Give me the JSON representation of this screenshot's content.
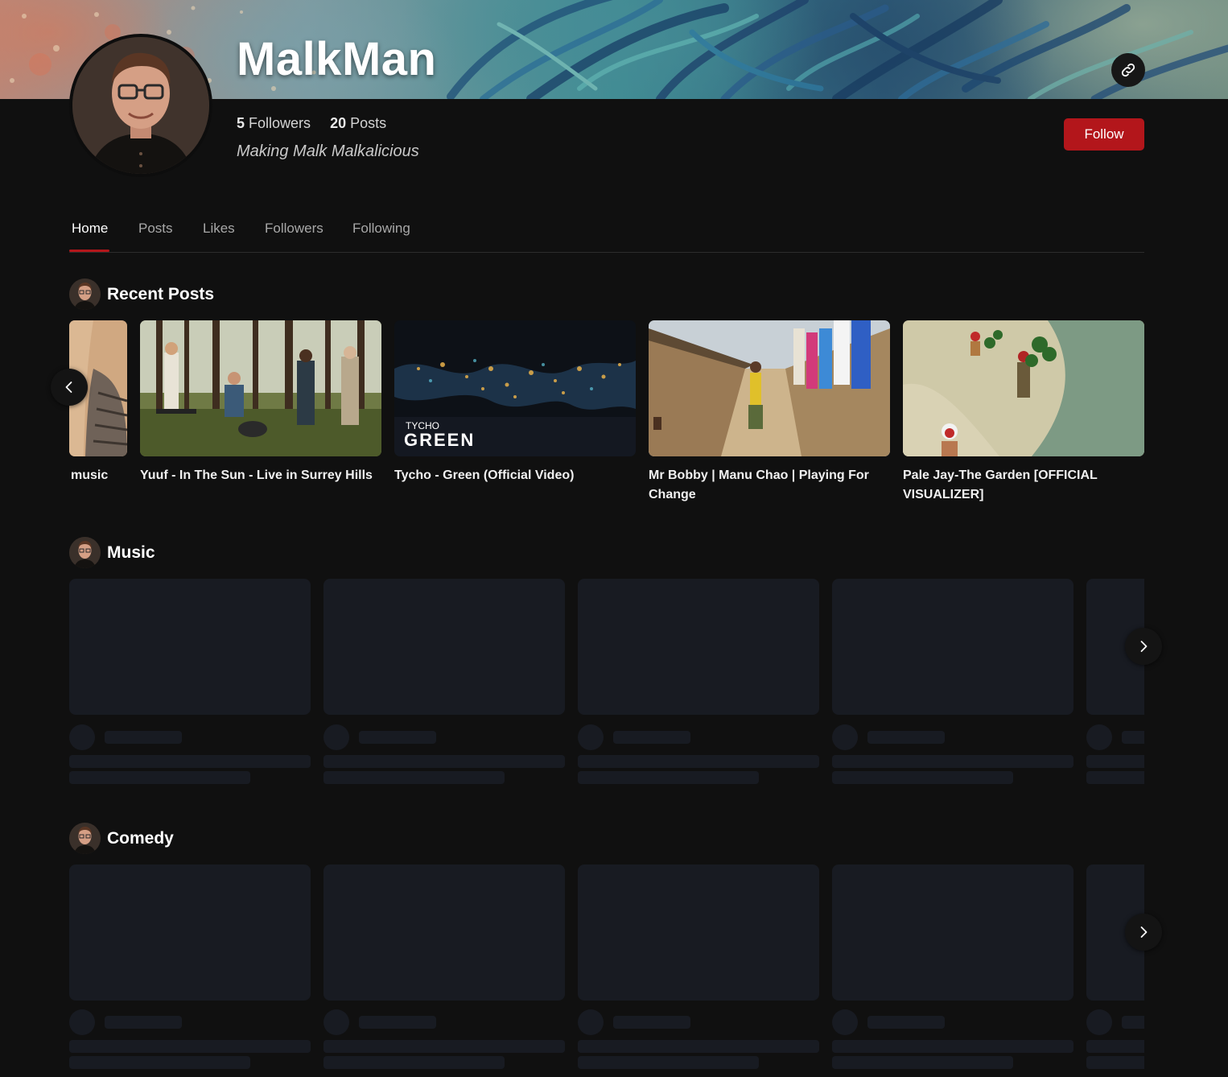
{
  "profile": {
    "name": "MalkMan",
    "followers_count": "5",
    "followers_label": "Followers",
    "posts_count": "20",
    "posts_label": "Posts",
    "tagline": "Making Malk Malkalicious",
    "follow_label": "Follow",
    "share_icon": "link-icon"
  },
  "tabs": [
    {
      "label": "Home",
      "active": true
    },
    {
      "label": "Posts",
      "active": false
    },
    {
      "label": "Likes",
      "active": false
    },
    {
      "label": "Followers",
      "active": false
    },
    {
      "label": "Following",
      "active": false
    }
  ],
  "sections": {
    "recent": {
      "title": "Recent Posts",
      "posts": [
        {
          "title": "music"
        },
        {
          "title": "Yuuf - In The Sun - Live in Surrey Hills"
        },
        {
          "title": "Tycho - Green (Official Video)",
          "thumb_text_small": "TYCHO",
          "thumb_text_big": "GREEN"
        },
        {
          "title": "Mr Bobby | Manu Chao | Playing For Change"
        },
        {
          "title": "Pale Jay-The Garden [OFFICIAL VISUALIZER]"
        }
      ]
    },
    "music": {
      "title": "Music"
    },
    "comedy": {
      "title": "Comedy"
    }
  },
  "colors": {
    "accent": "#b3161b",
    "background": "#101010",
    "skeleton": "#181b22"
  }
}
